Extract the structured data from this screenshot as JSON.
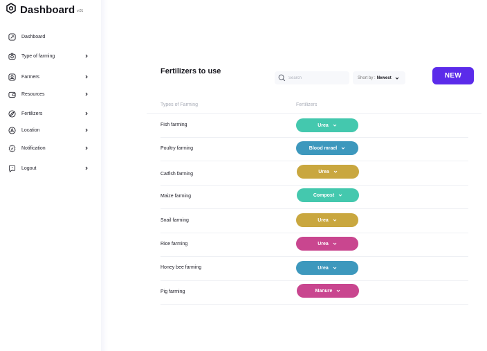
{
  "brand": {
    "title": "Dashboard",
    "version": "v.01"
  },
  "sidebar": {
    "items": [
      {
        "label": "Dashboard",
        "icon": "dashboard-icon",
        "chevron": false
      },
      {
        "label": "Type of farming",
        "icon": "camera-icon",
        "chevron": true
      },
      {
        "label": "Farmers",
        "icon": "user-icon",
        "chevron": true
      },
      {
        "label": "Resources",
        "icon": "wallet-icon",
        "chevron": true
      },
      {
        "label": "Fertilizers",
        "icon": "compass-icon",
        "chevron": true
      },
      {
        "label": "Location",
        "icon": "location-icon",
        "chevron": true
      },
      {
        "label": "Notification",
        "icon": "badge-icon",
        "chevron": true
      },
      {
        "label": "Logout",
        "icon": "logout-icon",
        "chevron": true
      }
    ]
  },
  "main": {
    "title": "Fertilizers to use",
    "search_placeholder": "Search",
    "sort": {
      "prefix": "Short by :",
      "value": "Newest"
    },
    "new_button": "NEW",
    "columns": {
      "type": "Types of Farming",
      "fertilizer": "Fertilizers"
    },
    "rows": [
      {
        "farming": "Fish farming",
        "fertilizer": "Urea",
        "color": "#44c8ae"
      },
      {
        "farming": "Poultry farming",
        "fertilizer": "Blood mrael",
        "color": "#3d98bd"
      },
      {
        "farming": "Catfish farming",
        "fertilizer": "Urea",
        "color": "#c9a73f"
      },
      {
        "farming": "Maize farming",
        "fertilizer": "Compost",
        "color": "#44c8ae"
      },
      {
        "farming": "Snail farming",
        "fertilizer": "Urea",
        "color": "#c9a73f"
      },
      {
        "farming": "Rice farming",
        "fertilizer": "Urea",
        "color": "#c9468f"
      },
      {
        "farming": "Honey bee farming",
        "fertilizer": "Urea",
        "color": "#3d98bd"
      },
      {
        "farming": "Pig farming",
        "fertilizer": "Manure",
        "color": "#c9468f"
      }
    ]
  }
}
